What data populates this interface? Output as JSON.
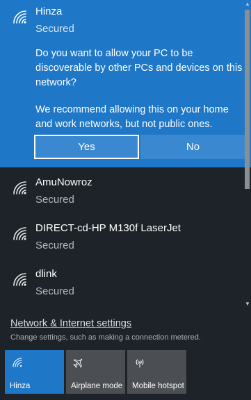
{
  "selected_network": {
    "name": "Hinza",
    "status": "Secured",
    "icon": "wifi-icon",
    "prompt_question": "Do you want to allow your PC to be discoverable by other PCs and devices on this network?",
    "prompt_recommendation": "We recommend allowing this on your home and work networks, but not public ones.",
    "yes_label": "Yes",
    "no_label": "No"
  },
  "networks": [
    {
      "name": "AmuNowroz",
      "status": "Secured",
      "icon": "wifi-icon"
    },
    {
      "name": "DIRECT-cd-HP M130f LaserJet",
      "status": "Secured",
      "icon": "wifi-icon"
    },
    {
      "name": "dlink",
      "status": "Secured",
      "icon": "wifi-icon"
    }
  ],
  "settings": {
    "link_label": "Network & Internet settings",
    "description": "Change settings, such as making a connection metered."
  },
  "quick_actions": [
    {
      "label": "Hinza",
      "icon": "wifi-icon",
      "active": true
    },
    {
      "label": "Airplane mode",
      "icon": "airplane-icon",
      "active": false
    },
    {
      "label": "Mobile hotspot",
      "icon": "hotspot-icon",
      "active": false
    }
  ],
  "colors": {
    "accent": "#1f77c8",
    "background": "#1d2328",
    "tile": "#4b4f53"
  }
}
